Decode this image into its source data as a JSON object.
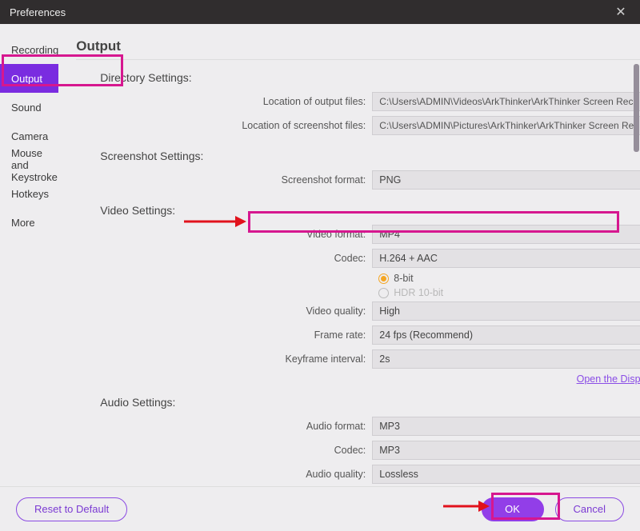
{
  "window": {
    "title": "Preferences"
  },
  "sidebar": {
    "items": [
      {
        "label": "Recording"
      },
      {
        "label": "Output"
      },
      {
        "label": "Sound"
      },
      {
        "label": "Camera"
      },
      {
        "label": "Mouse and Keystroke"
      },
      {
        "label": "Hotkeys"
      },
      {
        "label": "More"
      }
    ],
    "active_index": 1
  },
  "main": {
    "title": "Output",
    "directory": {
      "title": "Directory Settings:",
      "output_label": "Location of output files:",
      "output_value": "C:\\Users\\ADMIN\\Videos\\ArkThinker\\ArkThinker Screen Rec",
      "screenshot_label": "Location of screenshot files:",
      "screenshot_value": "C:\\Users\\ADMIN\\Pictures\\ArkThinker\\ArkThinker Screen Re"
    },
    "screenshot": {
      "title": "Screenshot Settings:",
      "format_label": "Screenshot format:",
      "format_value": "PNG"
    },
    "video": {
      "title": "Video Settings:",
      "format_label": "Video format:",
      "format_value": "MP4",
      "codec_label": "Codec:",
      "codec_value": "H.264 + AAC",
      "bit8_label": "8-bit",
      "hdr_label": "HDR 10-bit",
      "quality_label": "Video quality:",
      "quality_value": "High",
      "framerate_label": "Frame rate:",
      "framerate_value": "24 fps (Recommend)",
      "keyframe_label": "Keyframe interval:",
      "keyframe_value": "2s",
      "display_link": "Open the Display dialog"
    },
    "audio": {
      "title": "Audio Settings:",
      "format_label": "Audio format:",
      "format_value": "MP3",
      "codec_label": "Codec:",
      "codec_value": "MP3",
      "quality_label": "Audio quality:",
      "quality_value": "Lossless"
    }
  },
  "footer": {
    "reset": "Reset to Default",
    "ok": "OK",
    "cancel": "Cancel"
  }
}
